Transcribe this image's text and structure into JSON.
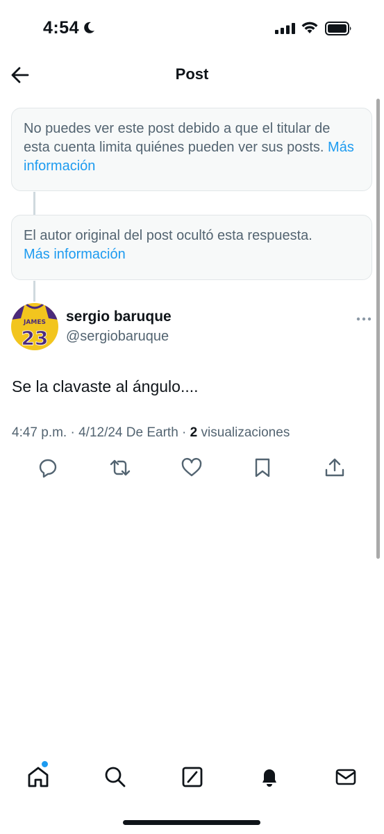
{
  "status_bar": {
    "time": "4:54"
  },
  "header": {
    "title": "Post"
  },
  "notices": [
    {
      "text": "No puedes ver este post debido a que el titular de esta cuenta limita quiénes pueden ver sus posts.",
      "link": "Más información"
    },
    {
      "text": "El autor original del post ocultó esta respuesta.",
      "link": "Más información"
    }
  ],
  "tweet": {
    "author_name": "sergio baruque",
    "handle": "@sergiobaruque",
    "avatar_jersey": {
      "name": "JAMES",
      "number": "23"
    },
    "text": "Se la clavaste al ángulo....",
    "time": "4:47 p.m.",
    "date": "4/12/24",
    "location": "De Earth",
    "views_count": "2",
    "views_label": "visualizaciones"
  },
  "actions": [
    "reply-icon",
    "retweet-icon",
    "like-icon",
    "bookmark-icon",
    "share-icon"
  ],
  "bottom_nav": [
    "home-icon",
    "search-icon",
    "grok-icon",
    "notifications-icon",
    "messages-icon"
  ],
  "colors": {
    "accent": "#1d9bf0",
    "text_primary": "#0f1419",
    "text_secondary": "#536471",
    "card_bg": "#f7f9f9"
  }
}
